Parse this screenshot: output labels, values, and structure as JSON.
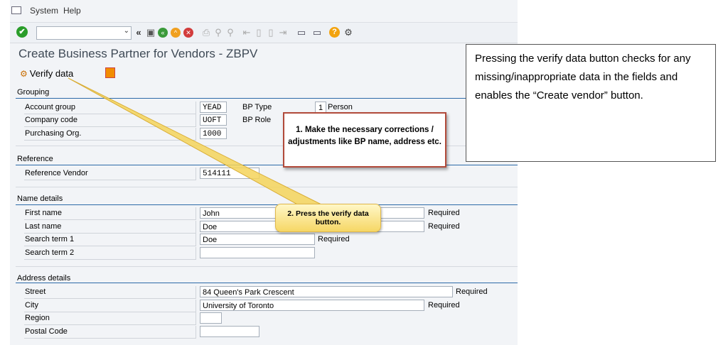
{
  "menubar": {
    "system": "System",
    "help": "Help"
  },
  "toolbar": {
    "command_field": {
      "value": ""
    },
    "icons": [
      "enter-icon",
      "back-icon",
      "save-icon",
      "back-green-icon",
      "exit-icon",
      "cancel-icon",
      "print-icon",
      "find-icon",
      "find-next-icon",
      "first-page-icon",
      "previous-page-icon",
      "next-page-icon",
      "last-page-icon",
      "new-session-icon",
      "shortcut-icon",
      "help-icon",
      "settings-icon"
    ]
  },
  "page": {
    "title": "Create Business Partner for Vendors - ZBPV",
    "verify_label": "Verify data"
  },
  "grouping": {
    "title": "Grouping",
    "account_group_label": "Account group",
    "account_group_value": "YEAD",
    "company_code_label": "Company code",
    "company_code_value": "UOFT",
    "purchasing_org_label": "Purchasing Org.",
    "purchasing_org_value": "1000",
    "bp_type_label": "BP Type",
    "bp_type_code": "1",
    "bp_type_text": "Person",
    "bp_role_label": "BP Role"
  },
  "reference": {
    "title": "Reference",
    "vendor_label": "Reference Vendor",
    "vendor_value": "514111"
  },
  "name_details": {
    "title": "Name details",
    "first_name_label": "First name",
    "first_name_value": "John",
    "last_name_label": "Last name",
    "last_name_value": "Doe",
    "search1_label": "Search term 1",
    "search1_value": "Doe",
    "search2_label": "Search term 2",
    "search2_value": "",
    "required": "Required"
  },
  "address_details": {
    "title": "Address details",
    "street_label": "Street",
    "street_value": "84 Queen's Park Crescent",
    "city_label": "City",
    "city_value": "University of Toronto",
    "region_label": "Region",
    "region_value": "",
    "postal_label": "Postal Code",
    "postal_value": "",
    "required": "Required"
  },
  "annotations": {
    "note": "Pressing the verify data button checks for any missing/inappropriate data in the fields and enables the “Create vendor” button.",
    "callout1": "1. Make the necessary corrections / adjustments like BP name, address etc.",
    "callout2": "2. Press the verify data button."
  },
  "colors": {
    "section_line": "#2c6aa8",
    "callout1_border": "#b14a3a",
    "callout2_fill": "#f6d765",
    "enter_green": "#2a9d2a"
  }
}
